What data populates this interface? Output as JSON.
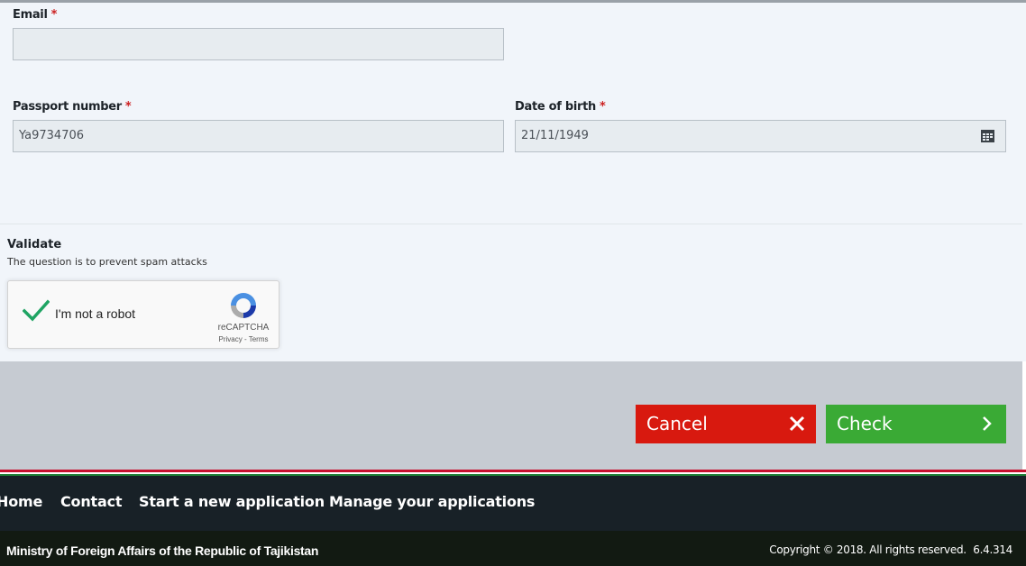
{
  "form": {
    "email": {
      "label": "Email",
      "required_mark": "*",
      "value": ""
    },
    "passport": {
      "label": "Passport number",
      "required_mark": "*",
      "value": "Ya9734706"
    },
    "dob": {
      "label": "Date of birth",
      "required_mark": "*",
      "value": "21/11/1949",
      "icon": "calendar-icon"
    }
  },
  "validate": {
    "title": "Validate",
    "subtitle": "The question is to prevent spam attacks",
    "captcha": {
      "label": "I'm not a robot",
      "checked": true,
      "brand": "reCAPTCHA",
      "links": "Privacy - Terms"
    }
  },
  "actions": {
    "cancel_label": "Cancel",
    "cancel_icon": "close-icon",
    "cancel_color": "#d8190f",
    "check_label": "Check",
    "check_icon": "chevron-right-icon",
    "check_color": "#3aaa35"
  },
  "nav": {
    "items": [
      {
        "label": "Home"
      },
      {
        "label": "Contact"
      },
      {
        "label": "Start a new application"
      },
      {
        "label": "Manage your applications"
      }
    ]
  },
  "footer": {
    "org": "Ministry of Foreign Affairs of the Republic of Tajikistan",
    "copyright": "Copyright © 2018. All rights reserved.",
    "version": "6.4.314"
  }
}
